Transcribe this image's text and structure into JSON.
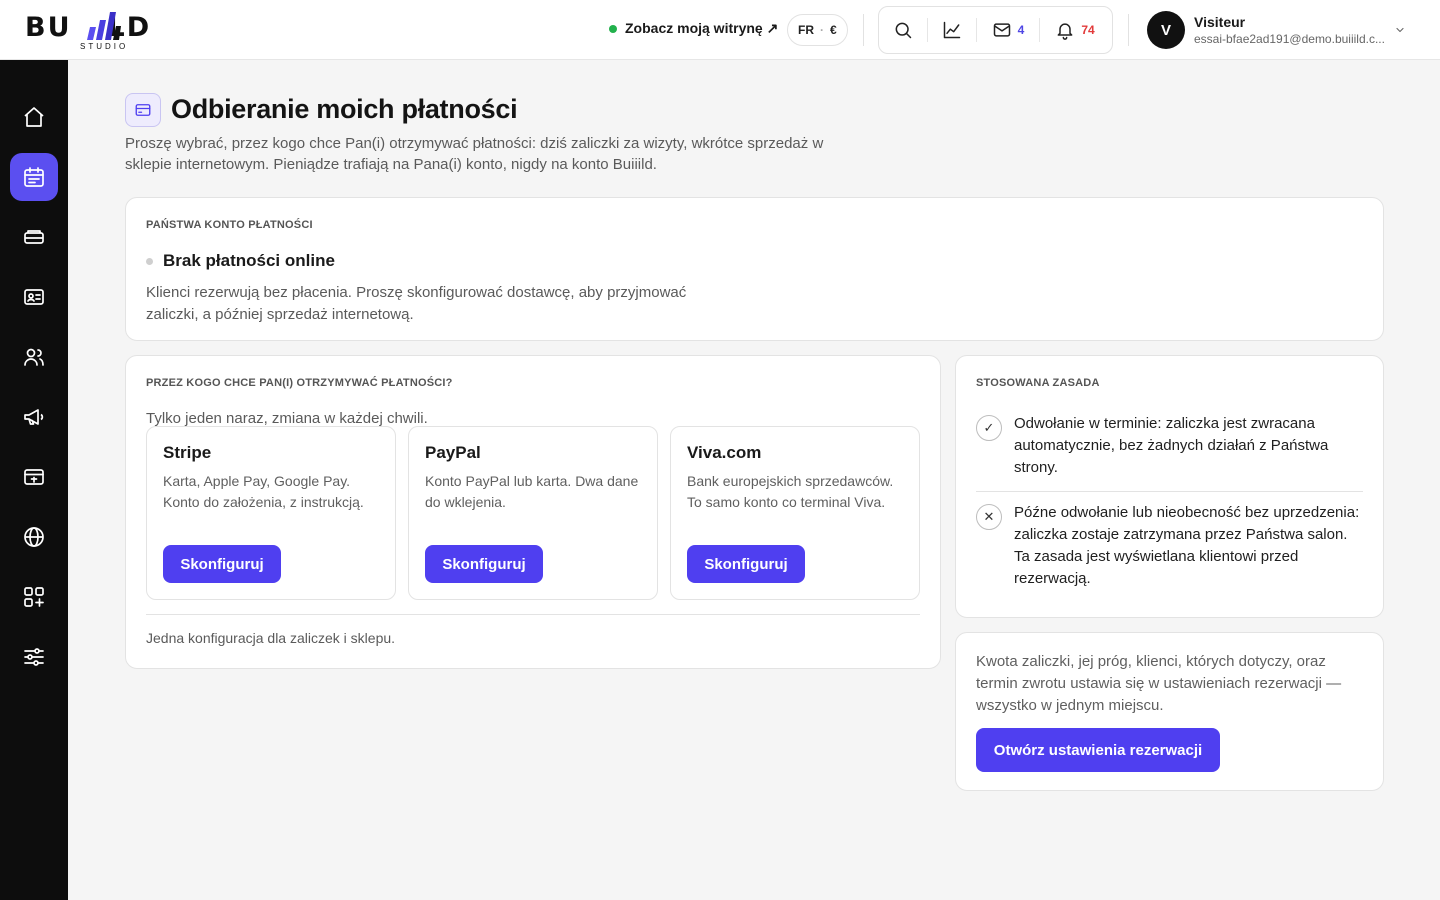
{
  "brand": {
    "logo_left": "BU",
    "logo_right": "LD",
    "logo_sub": "STUDIO"
  },
  "header": {
    "site_link": "Zobacz moją witrynę ↗",
    "locale_lang": "FR",
    "locale_sep": "·",
    "locale_currency": "€",
    "messages_count": "4",
    "notifications_count": "74",
    "user_initial": "V",
    "user_name": "Visiteur",
    "user_email": "essai-bfae2ad191@demo.buiiild.c..."
  },
  "page": {
    "title": "Odbieranie moich płatności",
    "description": "Proszę wybrać, przez kogo chce Pan(i) otrzymywać płatności: dziś zaliczki za wizyty, wkrótce sprzedaż w sklepie internetowym. Pieniądze trafiają na Pana(i) konto, nigdy na konto Buiiild."
  },
  "account": {
    "eyebrow": "Państwa konto płatności",
    "status_title": "Brak płatności online",
    "status_desc": "Klienci rezerwują bez płacenia. Proszę skonfigurować dostawcę, aby przyjmować zaliczki, a później sprzedaż internetową."
  },
  "providers": {
    "eyebrow": "Przez kogo chce Pan(i) otrzymywać płatności?",
    "subtitle": "Tylko jeden naraz, zmiana w każdej chwili.",
    "items": [
      {
        "name": "Stripe",
        "desc": "Karta, Apple Pay, Google Pay. Konto do założenia, z instrukcją.",
        "button": "Skonfiguruj"
      },
      {
        "name": "PayPal",
        "desc": "Konto PayPal lub karta. Dwa dane do wklejenia.",
        "button": "Skonfiguruj"
      },
      {
        "name": "Viva.com",
        "desc": "Bank europejskich sprzedawców. To samo konto co terminal Viva.",
        "button": "Skonfiguruj"
      }
    ],
    "footnote": "Jedna konfiguracja dla zaliczek i sklepu."
  },
  "policy": {
    "eyebrow": "Stosowana zasada",
    "rules": [
      {
        "icon": "✓",
        "text": "Odwołanie w terminie: zaliczka jest zwracana automatycznie, bez żadnych działań z Państwa strony."
      },
      {
        "icon": "✕",
        "text": "Późne odwołanie lub nieobecność bez uprzedzenia: zaliczka zostaje zatrzymana przez Państwa salon. Ta zasada jest wyświetlana klientowi przed rezerwacją."
      }
    ]
  },
  "deposit_info": {
    "text": "Kwota zaliczki, jej próg, klienci, których dotyczy, oraz termin zwrotu ustawia się w ustawieniach rezerwacji — wszystko w jednym miejscu.",
    "button": "Otwórz ustawienia rezerwacji"
  },
  "colors": {
    "accent": "#4f3ff0",
    "sidebar": "#0d0d0d",
    "status_online": "#22b14c",
    "alert": "#e23a3a"
  },
  "sidebar_icons": [
    "home-icon",
    "calendar-icon",
    "services-icon",
    "contact-card-icon",
    "users-icon",
    "megaphone-icon",
    "payment-terminal-icon",
    "globe-icon",
    "apps-icon",
    "sliders-icon"
  ]
}
